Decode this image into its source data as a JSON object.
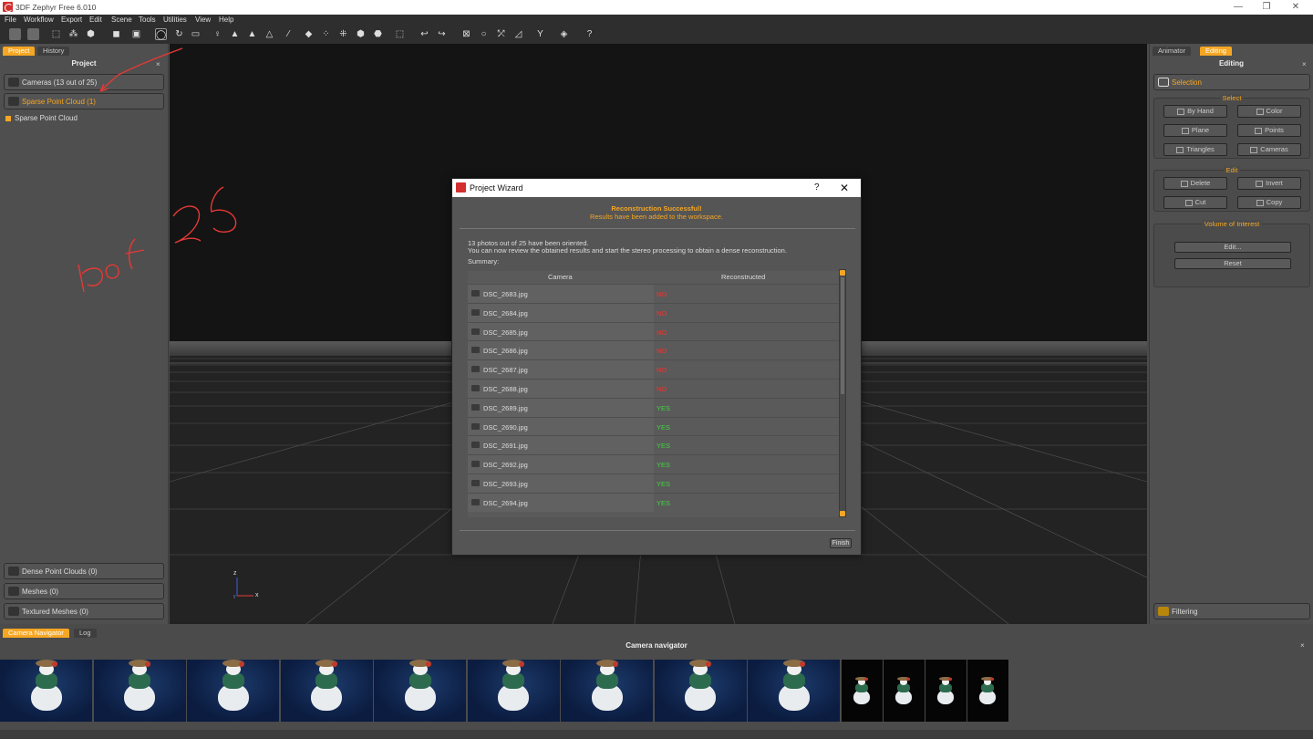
{
  "window": {
    "title": "3DF Zephyr Free 6.010"
  },
  "menu": [
    "File",
    "Workflow",
    "Export",
    "Edit",
    "Scene",
    "Tools",
    "Utilities",
    "View",
    "Help"
  ],
  "left": {
    "tabs": [
      "Project",
      "History"
    ],
    "header": "Project",
    "cameras": "Cameras (13 out of 25)",
    "sparse": "Sparse Point Cloud (1)",
    "tree_item": "Sparse Point Cloud",
    "dense": "Dense Point Clouds (0)",
    "meshes": "Meshes (0)",
    "textured": "Textured Meshes (0)"
  },
  "right": {
    "tabs": [
      "Animator",
      "Editing"
    ],
    "header": "Editing",
    "selection": "Selection",
    "select_title": "Select",
    "by_hand": "By Hand",
    "color": "Color",
    "plane": "Plane",
    "points": "Points",
    "triangles": "Triangles",
    "cameras": "Cameras",
    "edit_title": "Edit",
    "delete": "Delete",
    "invert": "Invert",
    "cut": "Cut",
    "copy": "Copy",
    "voi_title": "Volume of Interest",
    "edit_btn": "Edit...",
    "reset": "Reset",
    "filtering": "Filtering"
  },
  "bottom": {
    "tabs": [
      "Camera Navigator",
      "Log"
    ],
    "header": "Camera navigator"
  },
  "axes": {
    "z": "z",
    "x": "x",
    "y": "y"
  },
  "annotation": {
    "text": "13 of 25",
    "color": "#e53935"
  },
  "dialog": {
    "title": "Project Wizard",
    "help": "?",
    "close": "✕",
    "success": "Reconstruction Successful!",
    "sub": "Results have been added to the workspace.",
    "line1": "13 photos out of 25 have been oriented.",
    "line2": "You can now review the obtained results and start the stereo processing to obtain a dense reconstruction.",
    "summary": "Summary:",
    "col_camera": "Camera",
    "col_recon": "Reconstructed",
    "rows": [
      {
        "file": "DSC_2683.jpg",
        "status": "NO"
      },
      {
        "file": "DSC_2684.jpg",
        "status": "NO"
      },
      {
        "file": "DSC_2685.jpg",
        "status": "NO"
      },
      {
        "file": "DSC_2686.jpg",
        "status": "NO"
      },
      {
        "file": "DSC_2687.jpg",
        "status": "NO"
      },
      {
        "file": "DSC_2688.jpg",
        "status": "NO"
      },
      {
        "file": "DSC_2689.jpg",
        "status": "YES"
      },
      {
        "file": "DSC_2690.jpg",
        "status": "YES"
      },
      {
        "file": "DSC_2691.jpg",
        "status": "YES"
      },
      {
        "file": "DSC_2692.jpg",
        "status": "YES"
      },
      {
        "file": "DSC_2693.jpg",
        "status": "YES"
      },
      {
        "file": "DSC_2694.jpg",
        "status": "YES"
      }
    ],
    "finish": "Finish"
  },
  "colors": {
    "accent": "#f5a623",
    "no": "#e53935",
    "yes": "#43d243"
  }
}
